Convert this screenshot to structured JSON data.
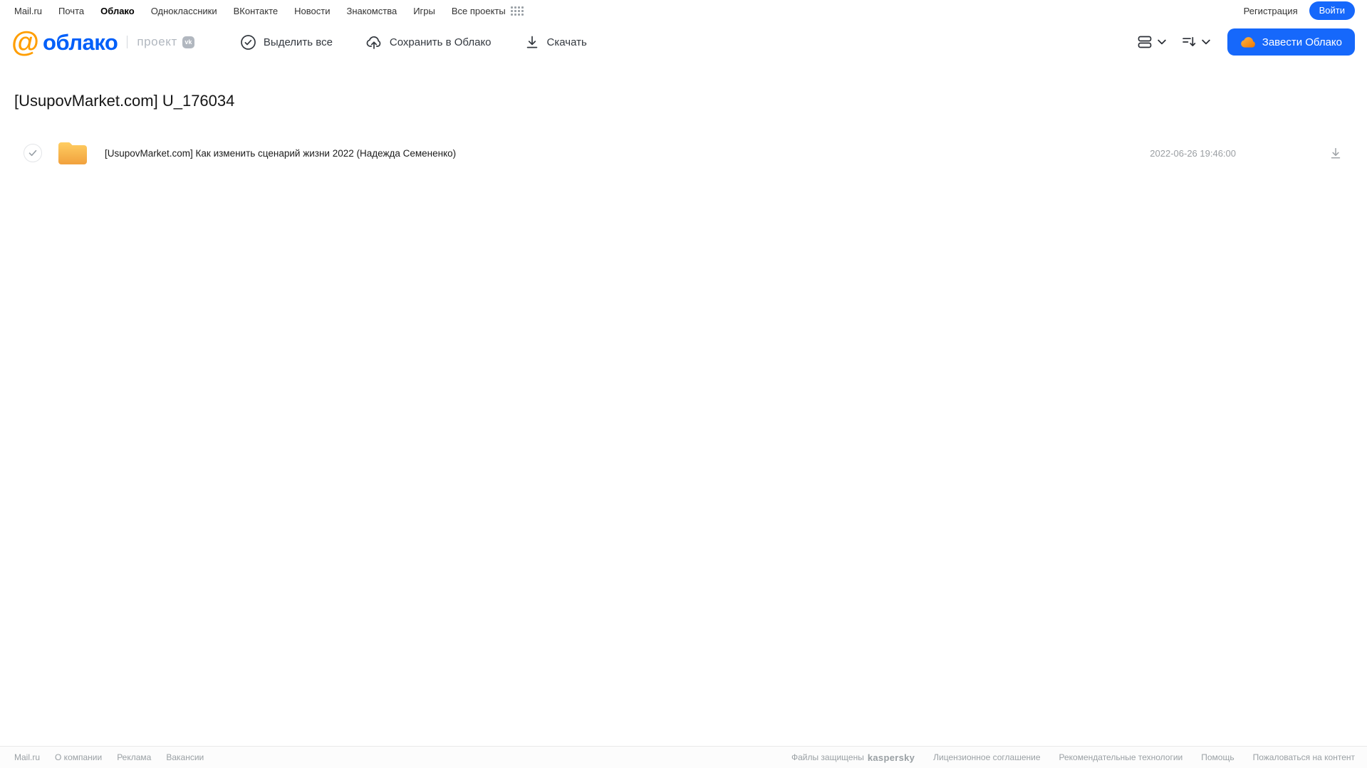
{
  "topnav": {
    "items": [
      {
        "label": "Mail.ru"
      },
      {
        "label": "Почта"
      },
      {
        "label": "Облако",
        "active": true
      },
      {
        "label": "Одноклассники"
      },
      {
        "label": "ВКонтакте"
      },
      {
        "label": "Новости"
      },
      {
        "label": "Знакомства"
      },
      {
        "label": "Игры"
      },
      {
        "label": "Все проекты"
      }
    ],
    "registration_label": "Регистрация",
    "login_label": "Войти"
  },
  "header": {
    "logo": {
      "at_symbol": "@",
      "text": "облако",
      "project_label": "проект",
      "vk_badge": "vk"
    },
    "toolbar": {
      "select_all": "Выделить все",
      "save_to_cloud": "Сохранить в Облако",
      "download": "Скачать"
    },
    "get_cloud_label": "Завести Облако"
  },
  "main": {
    "title": "[UsupovMarket.com] U_176034",
    "files": [
      {
        "name": "[UsupovMarket.com] Как изменить сценарий жизни 2022 (Надежда Семененко)",
        "modified": "2022-06-26 19:46:00"
      }
    ]
  },
  "footer": {
    "left_links": [
      {
        "label": "Mail.ru"
      },
      {
        "label": "О компании"
      },
      {
        "label": "Реклама"
      },
      {
        "label": "Вакансии"
      }
    ],
    "protected_label": "Файлы защищены",
    "kaspersky_label": "kaspersky",
    "right_links": [
      {
        "label": "Лицензионное соглашение"
      },
      {
        "label": "Рекомендательные технологии"
      },
      {
        "label": "Помощь"
      },
      {
        "label": "Пожаловаться на контент"
      }
    ]
  },
  "icons": {
    "apps-grid-icon": "⣿",
    "check-circle-icon": "✓",
    "cloud-upload-icon": "☁↑",
    "download-icon": "↓",
    "list-view-icon": "☰",
    "sort-icon": "⇅",
    "chevron-down-icon": "⌄",
    "cloud-icon": "☁",
    "folder-icon": "📁",
    "vk-icon": "vk",
    "at-logo-icon": "@"
  },
  "colors": {
    "brand_blue": "#005ff9",
    "accent_blue": "#1668fb",
    "logo_orange": "#ff9e00",
    "folder_top": "#ffce62",
    "folder_bottom": "#f1a13d",
    "kaspersky_green": "#00806e"
  }
}
